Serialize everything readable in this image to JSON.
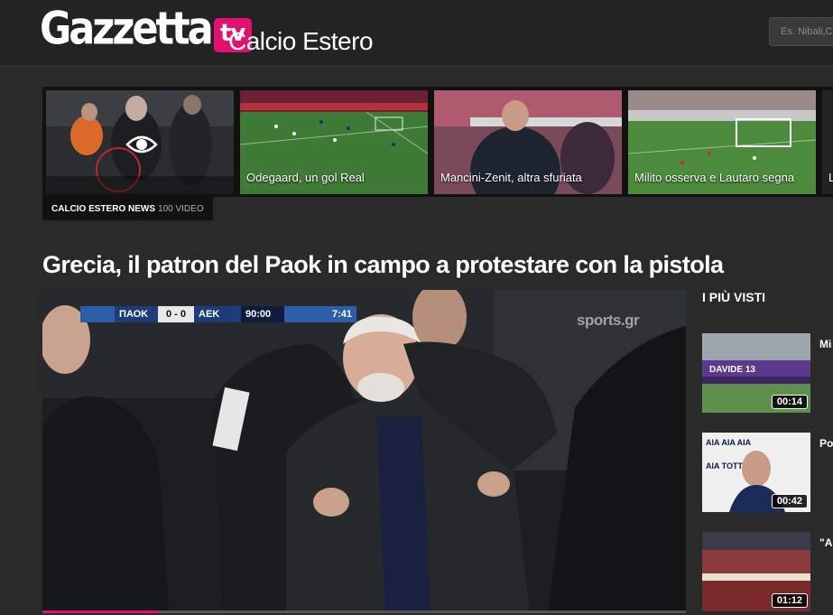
{
  "header": {
    "logo_word": "Gazzetta",
    "logo_tv": "tv",
    "section_title": "Calcio Estero",
    "search_placeholder": "Es. Nibali,C"
  },
  "carousel": {
    "play_icon": "eye-icon",
    "items": [
      {
        "caption": ""
      },
      {
        "caption": "Odegaard, un gol Real"
      },
      {
        "caption": "Mancini-Zenit, altra sfuriata"
      },
      {
        "caption": "Milito osserva e Lautaro segna"
      },
      {
        "caption": "L"
      }
    ],
    "playlist_name": "Calcio Estero News",
    "playlist_count": "100 VIDEO"
  },
  "article": {
    "title": "Grecia, il patron del Paok in campo a protestare con la pistola"
  },
  "player": {
    "scoreboard": {
      "home": "ΠΑΟΚ",
      "score": "0 - 0",
      "away": "AEK",
      "time": "90:00",
      "extra": "7:41"
    },
    "watermark": "sports.gr",
    "progress_fraction": 0.18
  },
  "sidebar": {
    "title": "I PIÙ VISTI",
    "items": [
      {
        "duration": "00:14",
        "text": "Mi co"
      },
      {
        "duration": "00:42",
        "text": "Po \"A"
      },
      {
        "duration": "01:12",
        "text": "\"A l'"
      }
    ]
  },
  "colors": {
    "accent": "#e1126f",
    "background": "#2a2a2a",
    "header": "#232323"
  }
}
